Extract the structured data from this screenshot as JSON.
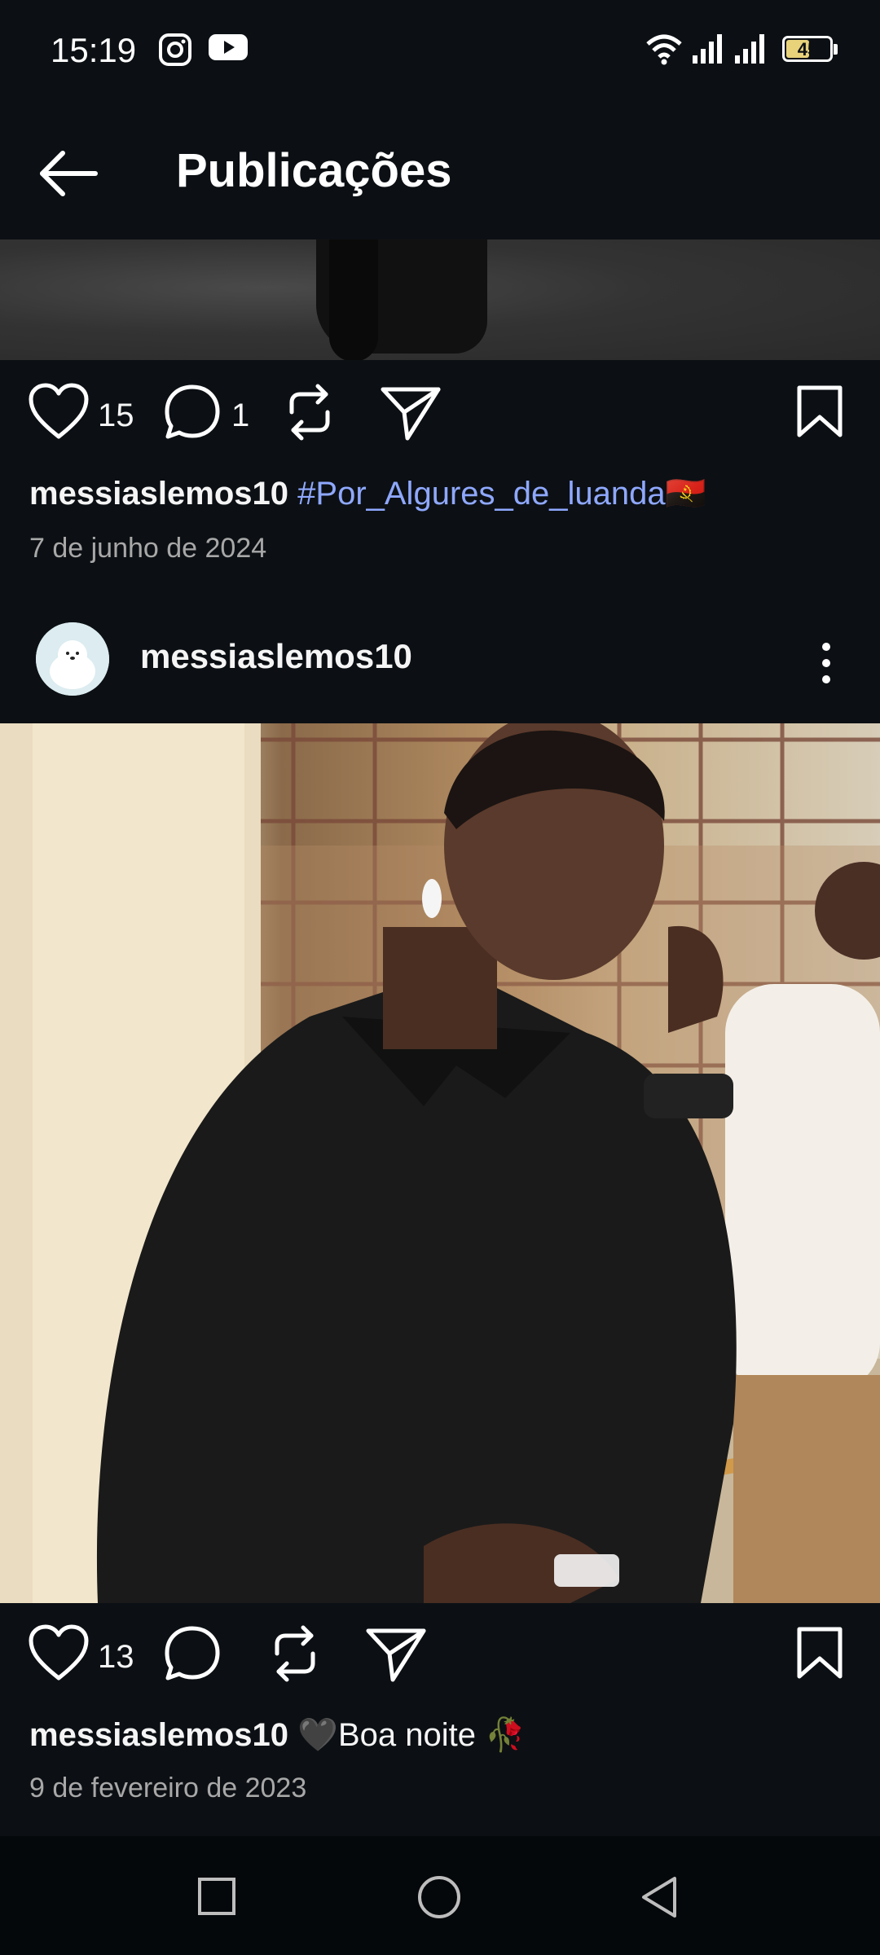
{
  "status_bar": {
    "time": "15:19",
    "battery": "45",
    "icons": [
      "instagram-icon",
      "youtube-icon",
      "wifi-icon",
      "signal-icon",
      "signal-icon",
      "battery-icon"
    ]
  },
  "header": {
    "title": "Publicações",
    "back_icon": "arrow-left-icon"
  },
  "posts": [
    {
      "likes": "15",
      "comments": "1",
      "username": "messiaslemos10",
      "caption_text": "#Por_Algures_de_luanda",
      "caption_emoji": "🇦🇴",
      "date": "7 de junho de 2024"
    },
    {
      "username": "messiaslemos10",
      "likes": "13",
      "caption_text": "🖤Boa noite 🥀",
      "date": "9 de fevereiro de 2023"
    }
  ],
  "nav_bar": {
    "icons": [
      "square-recents-icon",
      "circle-home-icon",
      "triangle-back-icon"
    ]
  },
  "colors": {
    "background": "#0c1014",
    "hashtag": "#8fa8ff",
    "secondary_text": "#a8a8a8"
  }
}
